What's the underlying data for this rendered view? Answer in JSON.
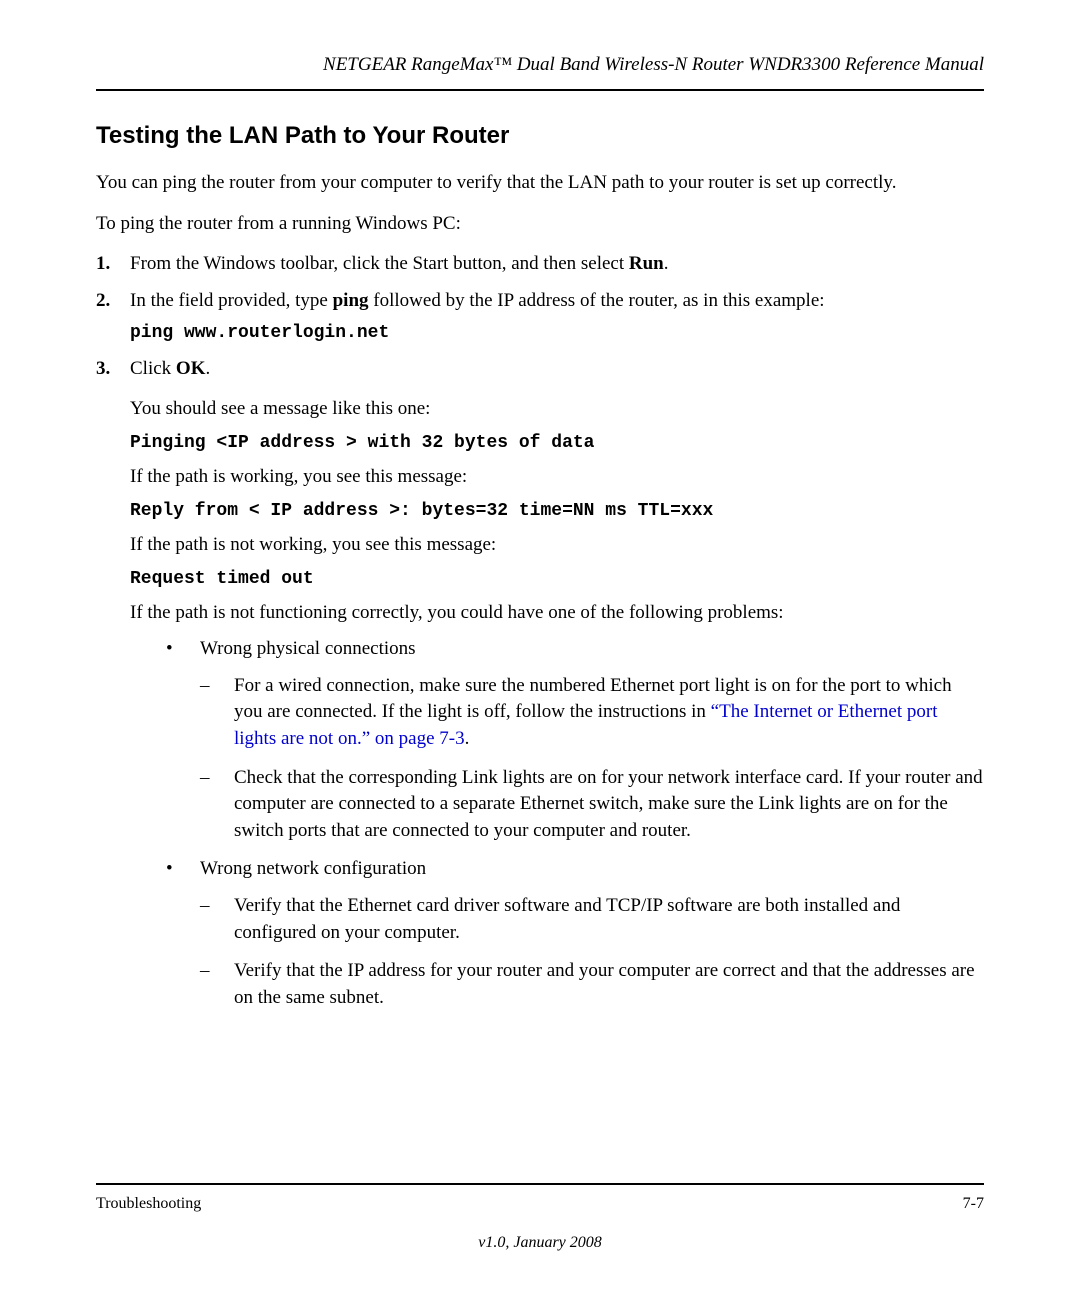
{
  "header": {
    "running": "NETGEAR RangeMax™ Dual Band Wireless-N Router WNDR3300 Reference Manual"
  },
  "section": {
    "title": "Testing the LAN Path to Your Router",
    "intro": "You can ping the router from your computer to verify that the LAN path to your router is set up correctly.",
    "lead": "To ping the router from a running Windows PC:"
  },
  "steps": {
    "s1": {
      "num": "1.",
      "pre": "From the Windows toolbar, click the Start button, and then select ",
      "bold": "Run",
      "post": "."
    },
    "s2": {
      "num": "2.",
      "pre": "In the field provided, type ",
      "bold": "ping",
      "post": " followed by the IP address of the router, as in this example:",
      "code": "ping www.routerlogin.net"
    },
    "s3": {
      "num": "3.",
      "pre": "Click ",
      "bold": "OK",
      "post": "."
    }
  },
  "after": {
    "p1": "You should see a message like this one:",
    "c1": "Pinging <IP address > with 32 bytes of data",
    "p2": "If the path is working, you see this message:",
    "c2": "Reply from < IP address >: bytes=32 time=NN ms TTL=xxx",
    "p3": "If the path is not working, you see this message:",
    "c3": "Request timed out",
    "p4": "If the path is not functioning correctly, you could have one of the following problems:"
  },
  "bullets": {
    "b1": {
      "label": "Wrong physical connections",
      "d1": {
        "pre": "For a wired connection, make sure the numbered Ethernet port light is on for the port to which you are connected. If the light is off, follow the instructions in ",
        "link": "“The Internet or Ethernet port lights are not on.” on page 7-3",
        "post": "."
      },
      "d2": "Check that the corresponding Link lights are on for your network interface card. If your router and computer are connected to a separate Ethernet switch, make sure the Link lights are on for the switch ports that are connected to your computer and router."
    },
    "b2": {
      "label": "Wrong network configuration",
      "d1": "Verify that the Ethernet card driver software and TCP/IP software are both installed and configured on your computer.",
      "d2": "Verify that the IP address for your router and your computer are correct and that the addresses are on the same subnet."
    }
  },
  "footer": {
    "left": "Troubleshooting",
    "right": "7-7",
    "center": "v1.0, January 2008"
  }
}
